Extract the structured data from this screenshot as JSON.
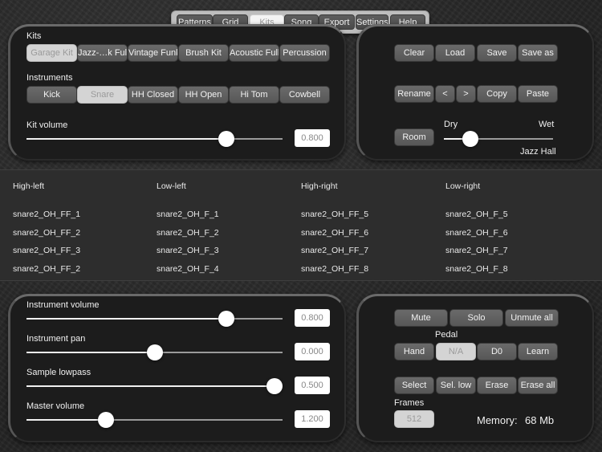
{
  "tabs": [
    {
      "label": "Patterns",
      "selected": false
    },
    {
      "label": "Grid",
      "selected": false
    },
    {
      "label": "Kits",
      "selected": true
    },
    {
      "label": "Song",
      "selected": false
    },
    {
      "label": "Export",
      "selected": false
    },
    {
      "label": "Settings",
      "selected": false
    },
    {
      "label": "Help",
      "selected": false
    }
  ],
  "kits_panel": {
    "kits_label": "Kits",
    "kits": [
      {
        "label": "Garage Kit",
        "selected": true
      },
      {
        "label": "Jazz-…k Full",
        "selected": false
      },
      {
        "label": "Vintage Funk",
        "selected": false
      },
      {
        "label": "Brush Kit",
        "selected": false
      },
      {
        "label": "Acoustic Full",
        "selected": false
      },
      {
        "label": "Percussion",
        "selected": false
      }
    ],
    "instruments_label": "Instruments",
    "instruments": [
      {
        "label": "Kick",
        "selected": false
      },
      {
        "label": "Snare",
        "selected": true
      },
      {
        "label": "HH Closed",
        "selected": false
      },
      {
        "label": "HH Open",
        "selected": false
      },
      {
        "label": "Hi Tom",
        "selected": false
      },
      {
        "label": "Cowbell",
        "selected": false
      }
    ],
    "kit_volume": {
      "label": "Kit volume",
      "value": "0.800",
      "fraction": 0.78
    }
  },
  "kit_actions": {
    "row1": [
      "Clear",
      "Load",
      "Save",
      "Save as"
    ],
    "row2": [
      "Rename",
      "<",
      ">",
      "Copy",
      "Paste"
    ],
    "room_button": "Room",
    "dry_label": "Dry",
    "wet_label": "Wet",
    "room_fraction": 0.24,
    "room_name": "Jazz Hall"
  },
  "samples": {
    "columns": [
      {
        "header": "High-left",
        "items": [
          "snare2_OH_FF_1",
          "snare2_OH_FF_2",
          "snare2_OH_FF_3",
          "snare2_OH_FF_2"
        ]
      },
      {
        "header": "Low-left",
        "items": [
          "snare2_OH_F_1",
          "snare2_OH_F_2",
          "snare2_OH_F_3",
          "snare2_OH_F_4"
        ]
      },
      {
        "header": "High-right",
        "items": [
          "snare2_OH_FF_5",
          "snare2_OH_FF_6",
          "snare2_OH_FF_7",
          "snare2_OH_FF_8"
        ]
      },
      {
        "header": "Low-right",
        "items": [
          "snare2_OH_F_5",
          "snare2_OH_F_6",
          "snare2_OH_F_7",
          "snare2_OH_F_8"
        ]
      }
    ]
  },
  "sliders_panel": [
    {
      "label": "Instrument volume",
      "value": "0.800",
      "fraction": 0.78
    },
    {
      "label": "Instrument pan",
      "value": "0.000",
      "fraction": 0.5
    },
    {
      "label": "Sample lowpass",
      "value": "0.500",
      "fraction": 0.97
    },
    {
      "label": "Master volume",
      "value": "1.200",
      "fraction": 0.31
    }
  ],
  "instrument_actions": {
    "row1": [
      "Mute",
      "Solo",
      "Unmute all"
    ],
    "pedal_label": "Pedal",
    "row2": [
      {
        "label": "Hand",
        "selected": false
      },
      {
        "label": "N/A",
        "selected": true
      },
      {
        "label": "D0",
        "selected": false
      },
      {
        "label": "Learn",
        "selected": false
      }
    ],
    "row3": [
      "Select",
      "Sel. low",
      "Erase",
      "Erase all"
    ],
    "frames_label": "Frames",
    "frames_value": "512",
    "memory_label": "Memory:",
    "memory_value": "68 Mb"
  }
}
